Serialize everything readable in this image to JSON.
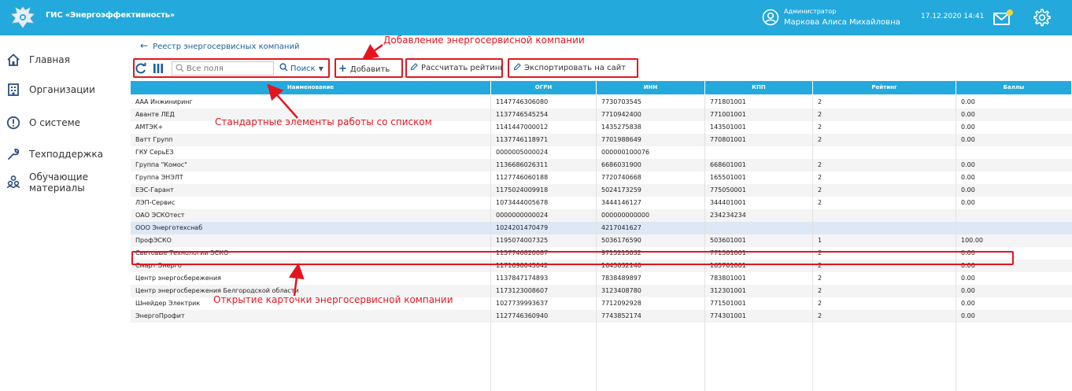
{
  "header": {
    "app_title": "ГИС «Энергоэффективность»",
    "user_role": "Администратор",
    "user_name": "Маркова Алиса Михайловна",
    "datetime": "17.12.2020 14:41",
    "brand_color": "#23a9dc",
    "icons": [
      "coat-of-arms-logo",
      "user-circle-icon",
      "mail-icon",
      "gear-icon"
    ]
  },
  "sidebar": {
    "items": [
      {
        "label": "Главная",
        "icon": "home-icon"
      },
      {
        "label": "Организации",
        "icon": "building-icon"
      },
      {
        "label": "О системе",
        "icon": "info-icon"
      },
      {
        "label": "Техподдержка",
        "icon": "wrench-icon"
      },
      {
        "label": "Обучающие\nматериалы",
        "icon": "people-icon"
      }
    ]
  },
  "breadcrumb": {
    "back_label": "Реестр энергосервисных компаний"
  },
  "toolbar": {
    "search_placeholder": "Все поля",
    "search_label": "Поиск",
    "add_label": "Добавить",
    "rating_label": "Рассчитать рейтинг",
    "export_label": "Экспортировать на сайт"
  },
  "table": {
    "columns": [
      "Наименование",
      "ОГРН",
      "ИНН",
      "КПП",
      "Рейтинг",
      "Баллы"
    ],
    "selected_row": 10,
    "rows": [
      [
        "ААА Инжиниринг",
        "1147746306080",
        "7730703545",
        "771801001",
        "2",
        "0.00"
      ],
      [
        "Аванте ЛЕД",
        "1137746545254",
        "7710942400",
        "771001001",
        "2",
        "0.00"
      ],
      [
        "АМТЭК+",
        "1141447000012",
        "1435275838",
        "143501001",
        "2",
        "0.00"
      ],
      [
        "Ватт Групп",
        "1137746118971",
        "7701988649",
        "770801001",
        "2",
        "0.00"
      ],
      [
        "ГКУ СерьЕЗ",
        "0000005000024",
        "000000100076",
        "",
        "",
        ""
      ],
      [
        "Группа \"Комос\"",
        "1136686026311",
        "6686031900",
        "668601001",
        "2",
        "0.00"
      ],
      [
        "Группа ЭНЭЛТ",
        "1127746060188",
        "7720740668",
        "165501001",
        "2",
        "0.00"
      ],
      [
        "ЕЭС-Гарант",
        "1175024009918",
        "5024173259",
        "775050001",
        "2",
        "0.00"
      ],
      [
        "ЛЭП-Сервис",
        "1073444005678",
        "3444146127",
        "344401001",
        "2",
        "0.00"
      ],
      [
        "ОАО ЭСКОтест",
        "0000000000024",
        "000000000000",
        "234234234",
        "",
        ""
      ],
      [
        "ООО Энерготехснаб",
        "1024201470479",
        "4217041627",
        "",
        "",
        ""
      ],
      [
        "ПрофЭСКО",
        "1195074007325",
        "5036176590",
        "503601001",
        "1",
        "100.00"
      ],
      [
        "Световые Технологии ЭСКО",
        "1157746820087",
        "9715215032",
        "771501001",
        "2",
        "0.00"
      ],
      [
        "Смарт Энерго",
        "1171690045042",
        "1645032140",
        "165701001",
        "2",
        "0.00"
      ],
      [
        "Центр энергосбережения",
        "1137847174893",
        "7838489897",
        "783801001",
        "2",
        "0.00"
      ],
      [
        "Центр энергосбережения Белгородской области",
        "1173123008607",
        "3123408780",
        "312301001",
        "2",
        "0.00"
      ],
      [
        "Шнейдер Электрик",
        "1027739993637",
        "7712092928",
        "771501001",
        "2",
        "0.00"
      ],
      [
        "ЭнергоПрофит",
        "1127746360940",
        "7743852174",
        "774301001",
        "2",
        "0.00"
      ]
    ]
  },
  "annotations": {
    "add_note": "Добавление энергосервисной компании",
    "list_note": "Стандартные элементы работы со списком",
    "card_note": "Открытие карточки энергосервисной компании",
    "color": "#e4151f"
  }
}
